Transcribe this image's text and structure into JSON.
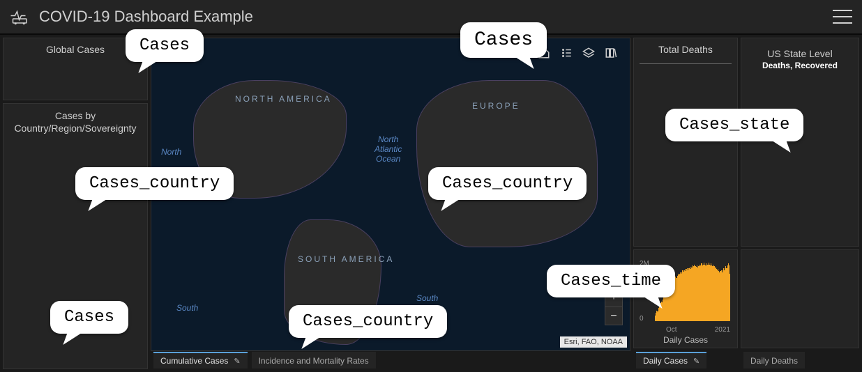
{
  "header": {
    "title": "COVID-19 Dashboard Example"
  },
  "left": {
    "global_cases_label": "Global Cases",
    "cases_by_label_l1": "Cases by",
    "cases_by_label_l2": "Country/Region/Sovereignty"
  },
  "map": {
    "labels": {
      "na": "NORTH AMERICA",
      "sa": "SOUTH AMERICA",
      "eu": "EUROPE",
      "n_atl_1": "North",
      "n_atl_2": "Atlantic",
      "n_atl_3": "Ocean",
      "np": "North",
      "south_l": "South",
      "south_r": "South"
    },
    "attribution": "Esri, FAO, NOAA",
    "tabs": {
      "cumulative": "Cumulative Cases",
      "incidence": "Incidence and Mortality Rates"
    }
  },
  "right1": {
    "total_deaths_label": "Total Deaths"
  },
  "right2": {
    "us_state_label": "US State Level",
    "us_state_sub": "Deaths, Recovered"
  },
  "chart_tabs": {
    "daily_cases": "Daily Cases",
    "daily_deaths": "Daily Deaths"
  },
  "chart_data": {
    "type": "bar",
    "title": "Daily Cases",
    "ylabel": "",
    "ylim": [
      0,
      2000000
    ],
    "yticks": [
      "2M",
      "0"
    ],
    "xticks": [
      "Oct",
      "2021"
    ],
    "values": [
      12,
      18,
      22,
      20,
      28,
      32,
      30,
      38,
      42,
      40,
      46,
      52,
      50,
      56,
      62,
      60,
      66,
      72,
      70,
      76,
      82,
      80,
      84,
      88,
      86,
      90,
      95,
      92,
      96,
      100,
      97,
      100,
      103,
      100,
      104,
      108,
      105,
      108,
      110,
      106,
      110,
      112,
      108,
      112,
      115,
      110,
      114,
      118,
      114,
      116,
      120,
      116,
      115,
      118,
      114,
      116,
      120,
      116,
      118,
      122,
      118,
      120,
      124,
      120,
      118,
      122,
      118,
      120,
      124,
      120,
      118,
      122,
      118,
      116,
      120,
      116,
      112,
      115,
      110,
      108,
      110,
      106,
      104,
      106,
      108,
      104,
      108,
      112,
      108,
      112,
      116,
      112,
      118,
      122,
      118,
      100
    ]
  },
  "bubbles": {
    "b1": "Cases",
    "b2": "Cases",
    "b3": "Cases_state",
    "b4": "Cases_country",
    "b5": "Cases_country",
    "b6": "Cases_time",
    "b7": "Cases",
    "b8": "Cases_country"
  }
}
